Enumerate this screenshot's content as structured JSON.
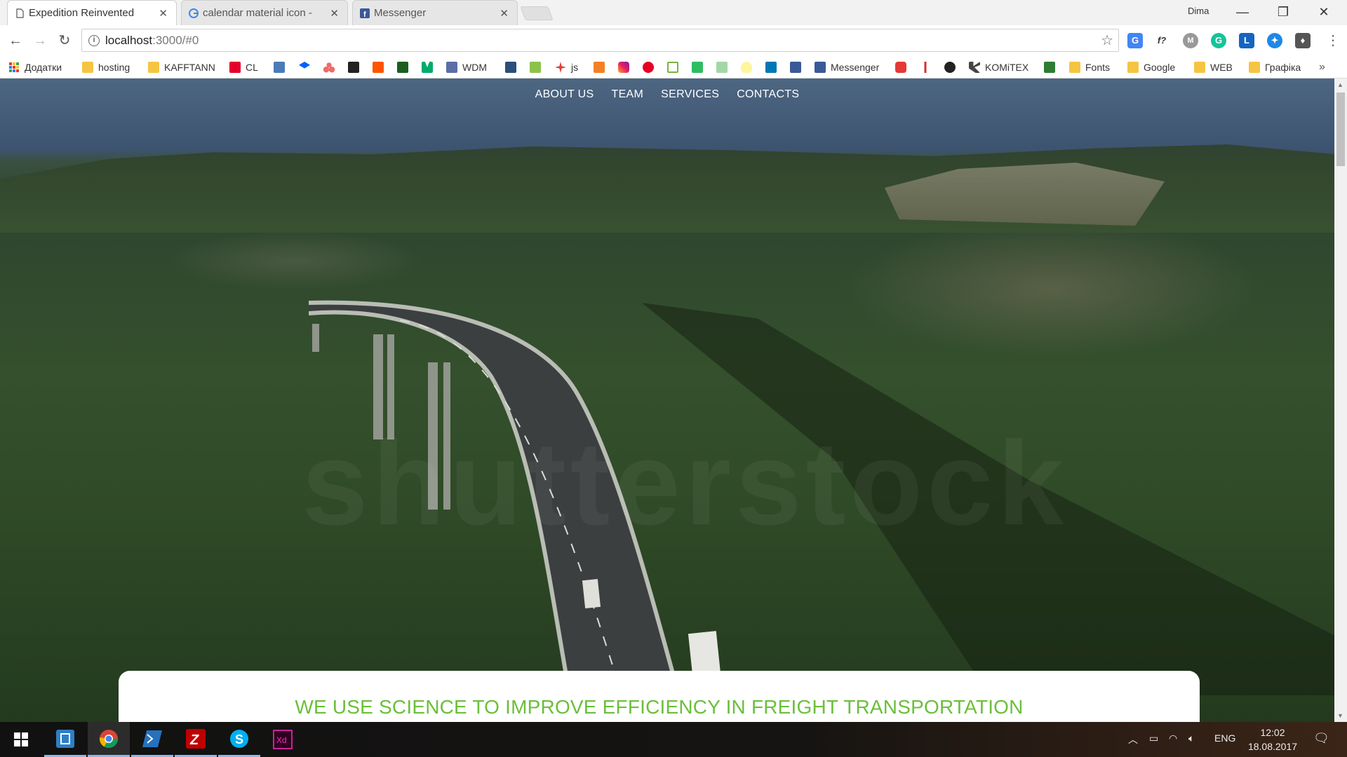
{
  "browser": {
    "tabs": [
      {
        "title": "Expedition Reinvented",
        "active": true
      },
      {
        "title": "calendar material icon - ",
        "active": false
      },
      {
        "title": "Messenger",
        "active": false
      }
    ],
    "profile_name": "Dima",
    "url_host": "localhost",
    "url_path": ":3000/#0",
    "bookmarks": [
      {
        "label": "Додатки",
        "icon": "apps-icon"
      },
      {
        "label": "hosting",
        "icon": "folder-icon"
      },
      {
        "label": "KAFFTANN",
        "icon": "folder-icon"
      },
      {
        "label": "CL",
        "icon": "adobe-icon"
      },
      {
        "label": "",
        "icon": "bookmark-icon"
      },
      {
        "label": "",
        "icon": "dropbox-icon"
      },
      {
        "label": "",
        "icon": "asana-icon"
      },
      {
        "label": "",
        "icon": "bookmark-icon"
      },
      {
        "label": "",
        "icon": "soundcloud-icon"
      },
      {
        "label": "",
        "icon": "bookmark-icon"
      },
      {
        "label": "",
        "icon": "medium-icon"
      },
      {
        "label": "WDM",
        "icon": "bookmark-icon"
      },
      {
        "label": "",
        "icon": "bookmark-icon"
      },
      {
        "label": "",
        "icon": "bookmark-icon"
      },
      {
        "label": "js",
        "icon": "bookmark-icon"
      },
      {
        "label": "",
        "icon": "stackoverflow-icon"
      },
      {
        "label": "",
        "icon": "instagram-icon"
      },
      {
        "label": "",
        "icon": "pinterest-icon"
      },
      {
        "label": "",
        "icon": "olx-icon"
      },
      {
        "label": "",
        "icon": "evernote-icon"
      },
      {
        "label": "",
        "icon": "bookmark-icon"
      },
      {
        "label": "",
        "icon": "bulb-icon"
      },
      {
        "label": "",
        "icon": "linkedin-icon"
      },
      {
        "label": "",
        "icon": "facebook-icon"
      },
      {
        "label": "Messenger",
        "icon": "facebook-icon"
      },
      {
        "label": "",
        "icon": "youtube-icon"
      },
      {
        "label": "",
        "icon": "thermometer-icon"
      },
      {
        "label": "",
        "icon": "github-icon"
      },
      {
        "label": "KOMiTEX",
        "icon": "bookmark-icon"
      },
      {
        "label": "",
        "icon": "bookmark-icon"
      },
      {
        "label": "Fonts",
        "icon": "folder-icon"
      },
      {
        "label": "Google",
        "icon": "folder-icon"
      },
      {
        "label": "WEB",
        "icon": "folder-icon"
      },
      {
        "label": "Графіка",
        "icon": "folder-icon"
      }
    ],
    "more_bookmarks": "»",
    "extensions": [
      "translate-icon",
      "formula-icon",
      "m-icon",
      "grammarly-icon",
      "l-icon",
      "bookmark-ext-icon",
      "keep-icon"
    ]
  },
  "site": {
    "nav": [
      "ABOUT US",
      "TEAM",
      "SERVICES",
      "CONTACTS"
    ],
    "headline": "WE USE SCIENCE TO IMPROVE EFFICIENCY IN FREIGHT TRANSPORTATION",
    "watermark": "shutterstock",
    "accent_color": "#6bbf3b"
  },
  "taskbar": {
    "apps": [
      "windows-start-icon",
      "task-view-icon",
      "chrome-icon",
      "powershell-icon",
      "filezilla-icon",
      "skype-icon",
      "adobe-xd-icon"
    ],
    "language": "ENG",
    "time": "12:02",
    "date": "18.08.2017"
  }
}
